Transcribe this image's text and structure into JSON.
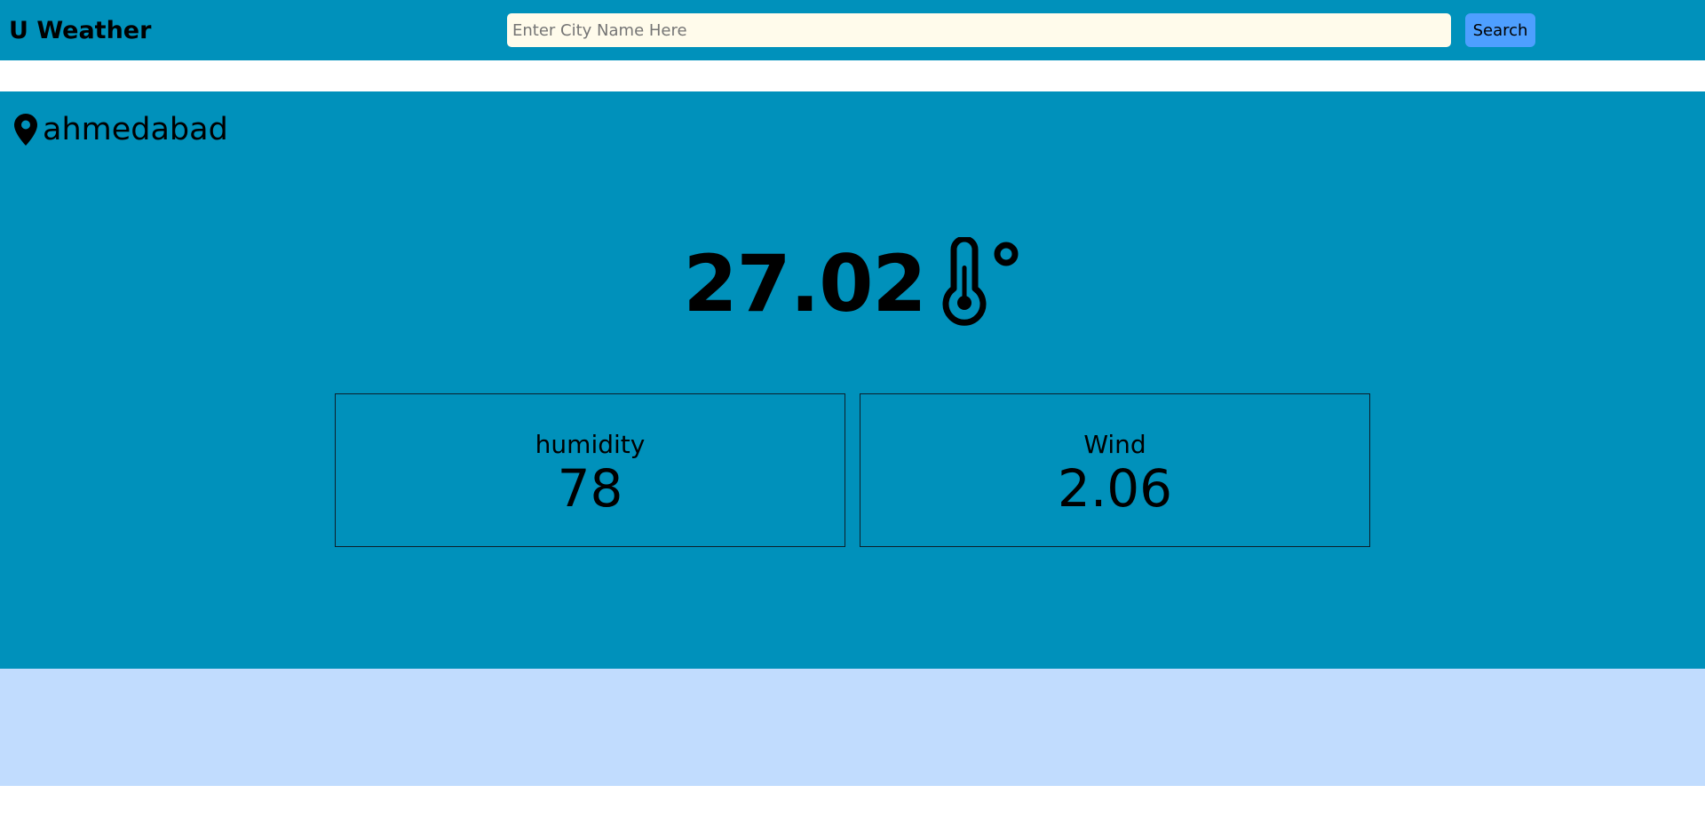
{
  "navbar": {
    "brand": "U Weather",
    "search_placeholder": "Enter City Name Here",
    "search_value": "",
    "search_label": "Search"
  },
  "weather": {
    "city": "ahmedabad",
    "temperature": "27.02",
    "humidity_label": "humidity",
    "humidity_value": "78",
    "wind_label": "Wind",
    "wind_value": "2.06"
  },
  "icons": {
    "location": "map-pin-icon",
    "temperature": "thermometer-degree-icon"
  },
  "colors": {
    "navbar_bg": "#0091bb",
    "panel_bg": "#0091bb",
    "search_bg": "#fffbeb",
    "button_bg": "#4e9fff",
    "footer_bg": "#c1dcfe"
  }
}
